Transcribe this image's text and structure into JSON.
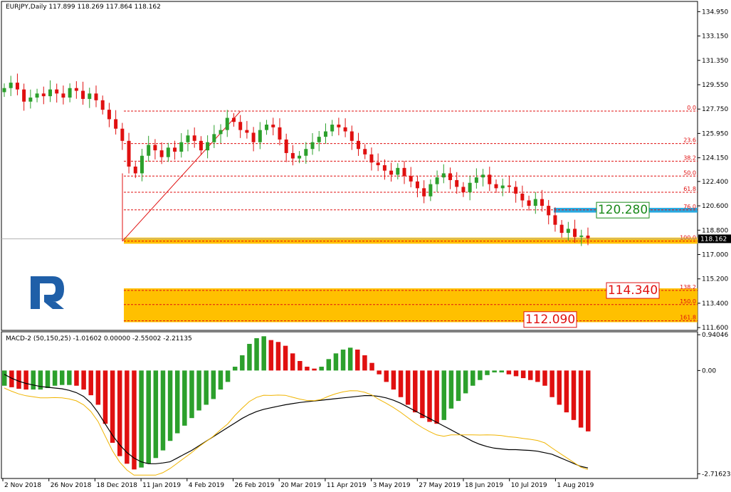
{
  "chart_data": {
    "type": "candlestick",
    "symbol_label": "EURJPY,Daily",
    "ohlc_label": "117.899 118.269 117.864 118.162",
    "current_price": "118.162",
    "y_range": [
      111.5,
      135.6
    ],
    "y_ticks": [
      "134.950",
      "133.150",
      "131.350",
      "129.550",
      "127.750",
      "125.950",
      "124.150",
      "122.400",
      "120.600",
      "118.800",
      "117.000",
      "115.200",
      "113.400",
      "111.600"
    ],
    "x_labels": [
      "2 Nov 2018",
      "26 Nov 2018",
      "18 Dec 2018",
      "11 Jan 2019",
      "4 Feb 2019",
      "26 Feb 2019",
      "20 Mar 2019",
      "11 Apr 2019",
      "3 May 2019",
      "27 May 2019",
      "18 Jun 2019",
      "10 Jul 2019",
      "1 Aug 2019"
    ],
    "close_path": [
      129.3,
      129.7,
      129.2,
      128.3,
      128.6,
      128.9,
      128.7,
      129.2,
      128.9,
      128.6,
      129.3,
      129.1,
      128.5,
      128.9,
      128.4,
      127.7,
      127.0,
      126.3,
      125.4,
      123.5,
      123.0,
      124.3,
      125.1,
      124.7,
      124.2,
      124.9,
      124.6,
      125.3,
      125.8,
      125.4,
      124.7,
      125.3,
      125.9,
      126.2,
      127.1,
      126.8,
      126.2,
      126.0,
      125.3,
      126.2,
      126.6,
      126.4,
      125.5,
      124.5,
      124.1,
      124.3,
      124.8,
      125.3,
      125.7,
      126.1,
      126.6,
      126.4,
      126.1,
      125.4,
      124.8,
      124.4,
      123.8,
      123.6,
      123.2,
      122.9,
      123.4,
      122.8,
      122.4,
      121.9,
      121.3,
      122.2,
      122.7,
      123.0,
      122.5,
      122.0,
      121.6,
      122.3,
      122.7,
      122.9,
      122.2,
      121.9,
      122.1,
      122.0,
      121.5,
      121.0,
      120.6,
      121.1,
      120.6,
      119.9,
      119.2,
      118.6,
      118.9,
      118.3,
      118.4,
      118.2
    ],
    "fibonacci": {
      "levels": [
        {
          "label": "0.0",
          "value": 127.6
        },
        {
          "label": "23.6",
          "value": 125.2
        },
        {
          "label": "38.2",
          "value": 123.9
        },
        {
          "label": "50.0",
          "value": 122.8
        },
        {
          "label": "61.8",
          "value": 121.6
        },
        {
          "label": "76.0",
          "value": 120.3
        },
        {
          "label": "100.0",
          "value": 117.99
        },
        {
          "label": "138.2",
          "value": 114.35
        },
        {
          "label": "150.0",
          "value": 113.3
        },
        {
          "label": "161.8",
          "value": 112.1
        }
      ],
      "zones": [
        {
          "from": 117.8,
          "to": 118.25,
          "color": "#ffc000"
        },
        {
          "from": 112.0,
          "to": 114.5,
          "color": "#ffc000"
        },
        {
          "from": 120.1,
          "to": 120.45,
          "color": "#29a9e0"
        }
      ]
    },
    "callouts": [
      {
        "text": "120.280",
        "value": 120.28,
        "color": "#1a8a1a"
      },
      {
        "text": "114.340",
        "value": 114.34,
        "color": "#e01010"
      },
      {
        "text": "112.090",
        "value": 112.09,
        "color": "#e01010"
      }
    ],
    "macd": {
      "label": "MACD-2 (50,150,25) -1.01602 0.00000 -2.55002 -2.21135",
      "y_range": [
        -2.8,
        0.98
      ],
      "y_ticks": [
        "0.94046",
        "0.00",
        "-2.71623"
      ],
      "histogram": [
        -0.4,
        -0.44,
        -0.48,
        -0.5,
        -0.5,
        -0.5,
        -0.46,
        -0.4,
        -0.38,
        -0.38,
        -0.4,
        -0.5,
        -0.65,
        -0.9,
        -1.4,
        -1.9,
        -2.25,
        -2.45,
        -2.6,
        -2.55,
        -2.45,
        -2.3,
        -2.1,
        -1.85,
        -1.65,
        -1.45,
        -1.25,
        -1.05,
        -0.9,
        -0.75,
        -0.5,
        -0.3,
        0.1,
        0.4,
        0.7,
        0.85,
        0.9,
        0.8,
        0.75,
        0.65,
        0.45,
        0.25,
        0.1,
        0.05,
        0.1,
        0.3,
        0.45,
        0.55,
        0.6,
        0.55,
        0.4,
        0.2,
        -0.1,
        -0.3,
        -0.5,
        -0.7,
        -0.9,
        -1.1,
        -1.25,
        -1.35,
        -1.4,
        -1.3,
        -1.0,
        -0.8,
        -0.6,
        -0.4,
        -0.25,
        -0.12,
        -0.05,
        -0.05,
        -0.1,
        -0.15,
        -0.2,
        -0.25,
        -0.3,
        -0.4,
        -0.7,
        -0.9,
        -1.1,
        -1.3,
        -1.5,
        -1.6
      ],
      "signal": [
        -0.1,
        -0.2,
        -0.28,
        -0.34,
        -0.38,
        -0.42,
        -0.44,
        -0.46,
        -0.48,
        -0.52,
        -0.58,
        -0.68,
        -0.85,
        -1.1,
        -1.4,
        -1.7,
        -1.95,
        -2.15,
        -2.3,
        -2.4,
        -2.45,
        -2.45,
        -2.43,
        -2.4,
        -2.3,
        -2.2,
        -2.1,
        -1.98,
        -1.86,
        -1.74,
        -1.62,
        -1.5,
        -1.38,
        -1.26,
        -1.16,
        -1.08,
        -1.02,
        -0.98,
        -0.94,
        -0.9,
        -0.87,
        -0.84,
        -0.82,
        -0.8,
        -0.78,
        -0.76,
        -0.74,
        -0.72,
        -0.7,
        -0.68,
        -0.66,
        -0.66,
        -0.68,
        -0.72,
        -0.78,
        -0.86,
        -0.96,
        -1.06,
        -1.16,
        -1.26,
        -1.36,
        -1.46,
        -1.56,
        -1.66,
        -1.76,
        -1.86,
        -1.94,
        -2.0,
        -2.04,
        -2.06,
        -2.08,
        -2.08,
        -2.09,
        -2.1,
        -2.12,
        -2.16,
        -2.2,
        -2.28,
        -2.36,
        -2.44,
        -2.52,
        -2.56
      ]
    }
  }
}
